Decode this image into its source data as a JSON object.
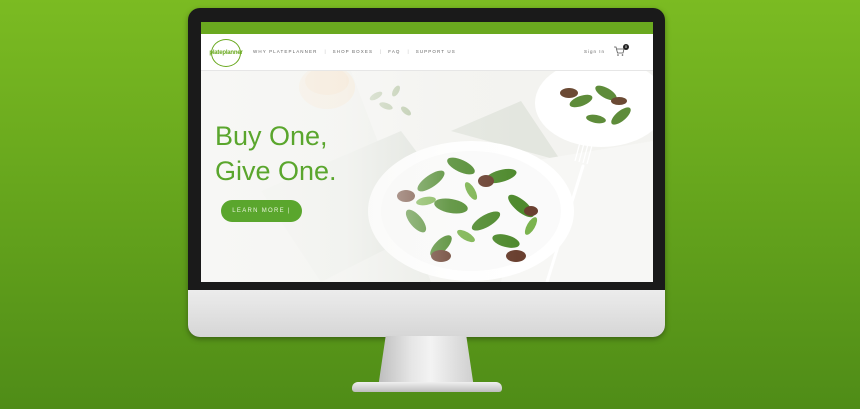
{
  "brand": {
    "logo_text": "plateplanner"
  },
  "nav": {
    "links": [
      "Why Plateplanner",
      "Shop Boxes",
      "FAQ",
      "Support Us"
    ],
    "sign_in": "Sign In",
    "cart_count": "0"
  },
  "hero": {
    "headline_line1": "Buy One,",
    "headline_line2": "Give One.",
    "cta_label": "LEARN MORE |"
  },
  "colors": {
    "background": "#6aa91f",
    "brand_green": "#5aa62d",
    "top_bar": "#6aa91f"
  }
}
